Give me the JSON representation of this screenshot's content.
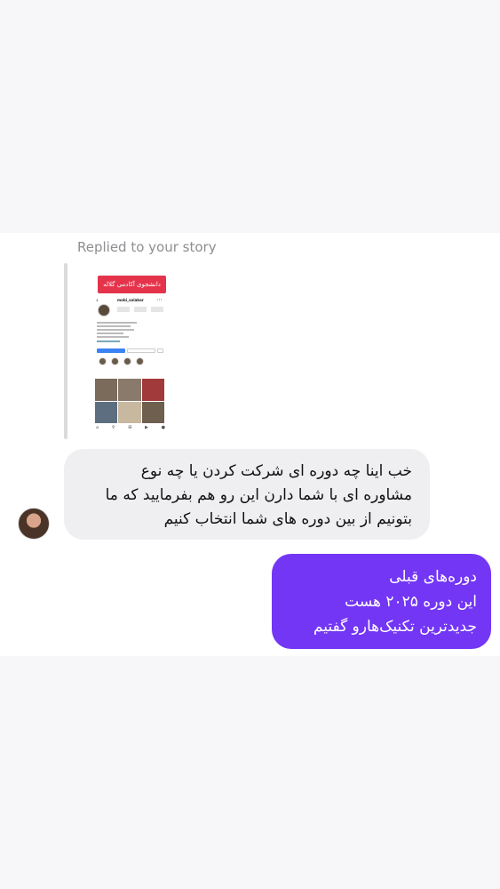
{
  "reply_header": "Replied to your story",
  "story": {
    "sticker_text": "دانشجوی آکادمی گلاله",
    "username": "mobi_salabar"
  },
  "incoming_message": {
    "lines": [
      "خب اینا چه دوره ای شرکت کردن یا چه نوع",
      "مشاوره ای با شما دارن این رو هم بفرمایید که ما",
      "بتونیم از بین دوره های شما انتخاب کنیم"
    ]
  },
  "outgoing_message": {
    "lines": [
      "دوره‌های قبلی",
      "این دوره ۲۰۲۵ هست",
      "جدیدترین تکنیک‌هارو گفتیم"
    ]
  },
  "colors": {
    "outgoing_bubble": "#7336f5",
    "incoming_bubble": "#efeff1",
    "sticker": "#e4334a"
  }
}
